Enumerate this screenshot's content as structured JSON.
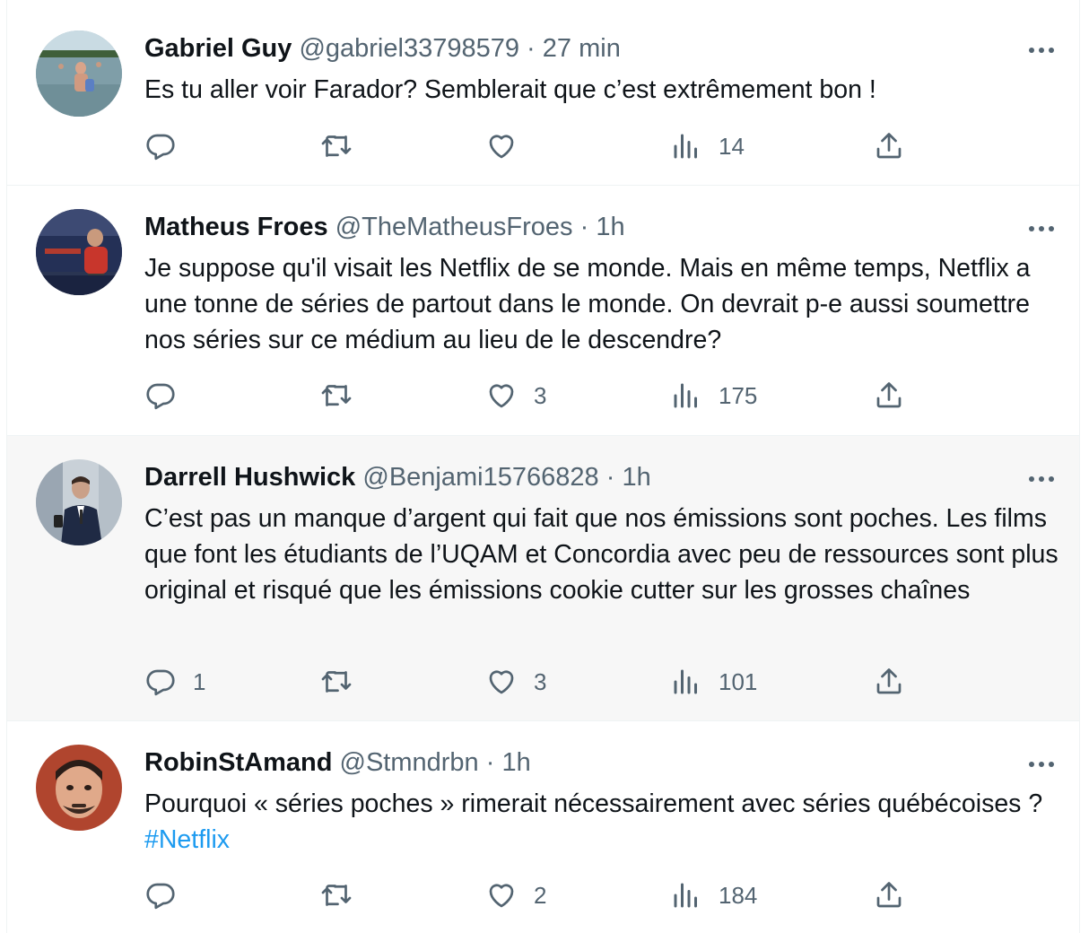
{
  "tweets": [
    {
      "name": "Gabriel Guy",
      "handle": "@gabriel33798579",
      "separator": "·",
      "time": "27 min",
      "text": "Es tu aller voir Farador? Semblerait que c’est extrêmement bon !",
      "replies": "",
      "retweets": "",
      "likes": "",
      "views": "14"
    },
    {
      "name": "Matheus Froes",
      "handle": "@TheMatheusFroes",
      "separator": "·",
      "time": "1h",
      "text": "Je suppose qu'il visait les Netflix de se monde. Mais en même temps, Netflix a une tonne de séries de partout dans le monde. On devrait p-e aussi soumettre nos séries sur ce médium au lieu de le descendre?",
      "replies": "",
      "retweets": "",
      "likes": "3",
      "views": "175"
    },
    {
      "name": "Darrell Hushwick",
      "handle": "@Benjami15766828",
      "separator": "·",
      "time": "1h",
      "text": "C’est pas un manque d’argent qui fait que nos émissions sont poches. Les films que font les étudiants de l’UQAM et Concordia avec peu de ressources sont plus original et risqué que les émissions cookie cutter sur les grosses chaînes",
      "replies": "1",
      "retweets": "",
      "likes": "3",
      "views": "101"
    },
    {
      "name": "RobinStAmand",
      "handle": "@Stmndrbn",
      "separator": "·",
      "time": "1h",
      "text_before": "Pourquoi « séries poches » rimerait nécessairement avec séries québécoises ? ",
      "hashtag": "#Netflix",
      "replies": "",
      "retweets": "",
      "likes": "2",
      "views": "184"
    }
  ],
  "icons": {
    "reply": "reply-icon",
    "retweet": "retweet-icon",
    "like": "heart-icon",
    "views": "views-chart-icon",
    "share": "share-icon",
    "more": "more-dots-icon"
  },
  "colors": {
    "text": "#0f1419",
    "secondary": "#536471",
    "link": "#1d9bf0",
    "hover_bg": "#f7f7f7",
    "border": "#eff3f4"
  }
}
